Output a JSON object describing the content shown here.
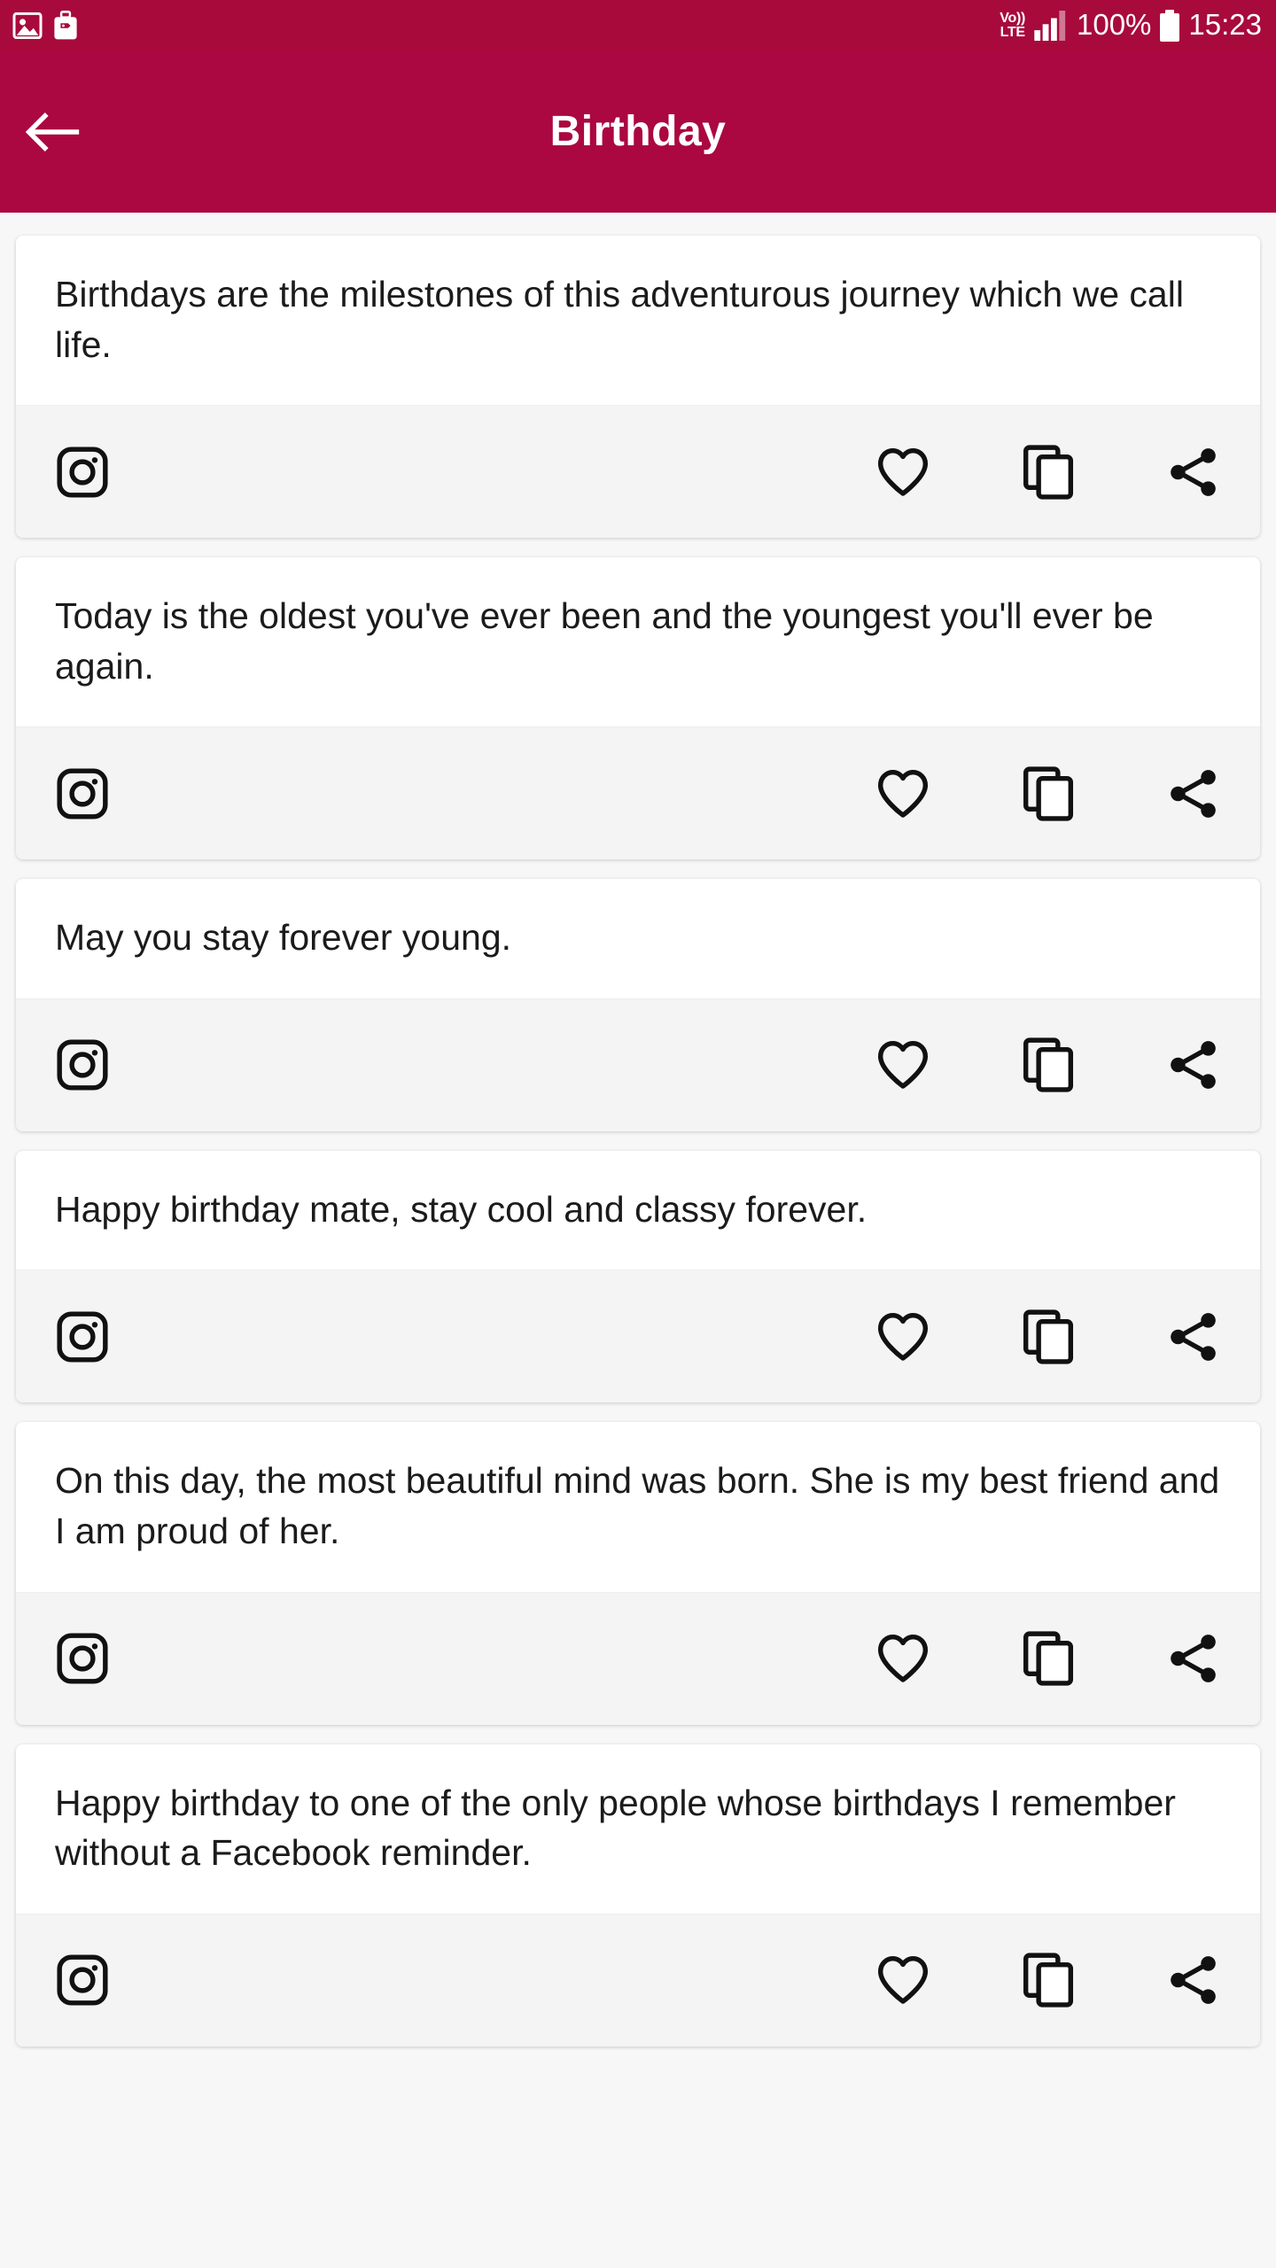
{
  "status_bar": {
    "left_icons": [
      "image-icon",
      "luggage-icon"
    ],
    "network_label_top": "Vo))",
    "network_label_bottom": "LTE",
    "signal_icon": "signal-bars-icon",
    "battery_percent": "100%",
    "battery_icon": "battery-full-icon",
    "time": "15:23"
  },
  "toolbar": {
    "back_icon": "back-arrow-icon",
    "title": "Birthday",
    "background_color": "#AB0740"
  },
  "theme": {
    "primary": "#AB0740",
    "status_bar": "#A80A3C",
    "page_background": "#f7f7f7",
    "card_background": "#ffffff",
    "action_bar_background": "#f4f4f4",
    "text_color": "#1b1b1b"
  },
  "card_actions": [
    {
      "name": "instagram-button",
      "icon": "instagram-icon"
    },
    {
      "name": "favorite-button",
      "icon": "heart-icon"
    },
    {
      "name": "copy-button",
      "icon": "copy-icon"
    },
    {
      "name": "share-button",
      "icon": "share-icon"
    }
  ],
  "cards": [
    {
      "quote": "Birthdays are the milestones of this adventurous journey which we call life."
    },
    {
      "quote": "Today is the oldest you've ever been and the youngest you'll ever be again."
    },
    {
      "quote": "May you stay forever young."
    },
    {
      "quote": "Happy birthday mate, stay cool and classy forever."
    },
    {
      "quote": "On this day, the most beautiful mind was born. She is my best friend and I am proud of her."
    },
    {
      "quote": "Happy birthday to one of the only people whose birthdays I remember without a Facebook reminder."
    }
  ]
}
